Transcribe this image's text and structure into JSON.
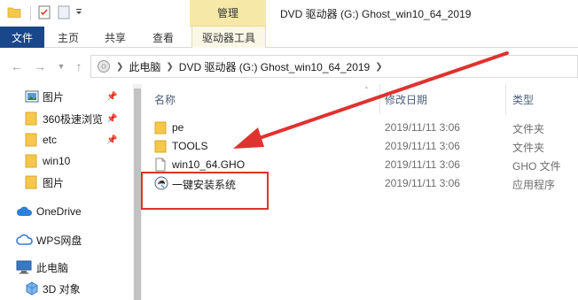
{
  "titlebar": {
    "manage_tab": "管理",
    "window_title": "DVD 驱动器 (G:) Ghost_win10_64_2019"
  },
  "ribbon": {
    "tabs": [
      "文件",
      "主页",
      "共享",
      "查看",
      "驱动器工具"
    ]
  },
  "address": {
    "crumbs": [
      "此电脑",
      "DVD 驱动器 (G:) Ghost_win10_64_2019"
    ]
  },
  "sidebar": {
    "items": [
      {
        "label": "图片",
        "icon": "pictures-icon",
        "pinned": true
      },
      {
        "label": "360极速浏览",
        "icon": "folder-icon",
        "pinned": true
      },
      {
        "label": "etc",
        "icon": "folder-icon",
        "pinned": true
      },
      {
        "label": "win10",
        "icon": "folder-icon",
        "pinned": false
      },
      {
        "label": "图片",
        "icon": "folder-icon",
        "pinned": false
      },
      {
        "label": "OneDrive",
        "icon": "onedrive-icon",
        "pinned": false
      },
      {
        "label": "WPS网盘",
        "icon": "wps-cloud-icon",
        "pinned": false
      },
      {
        "label": "此电脑",
        "icon": "this-pc-icon",
        "pinned": false
      },
      {
        "label": "3D 对象",
        "icon": "3d-objects-icon",
        "pinned": false
      }
    ]
  },
  "list": {
    "columns": {
      "name": "名称",
      "modified": "修改日期",
      "type": "类型"
    },
    "rows": [
      {
        "name": "pe",
        "date": "2019/11/11 3:06",
        "type": "文件夹",
        "icon": "folder-icon"
      },
      {
        "name": "TOOLS",
        "date": "2019/11/11 3:06",
        "type": "文件夹",
        "icon": "folder-icon"
      },
      {
        "name": "win10_64.GHO",
        "date": "2019/11/11 3:06",
        "type": "GHO 文件",
        "icon": "file-icon"
      },
      {
        "name": "一键安装系统",
        "date": "2019/11/11 3:06",
        "type": "应用程序",
        "icon": "installer-app-icon"
      }
    ]
  },
  "colors": {
    "file_tab": "#19478a",
    "manage_tab": "#f6e9a8",
    "annotation": "#e0322f",
    "folder": "#f5c74a"
  }
}
